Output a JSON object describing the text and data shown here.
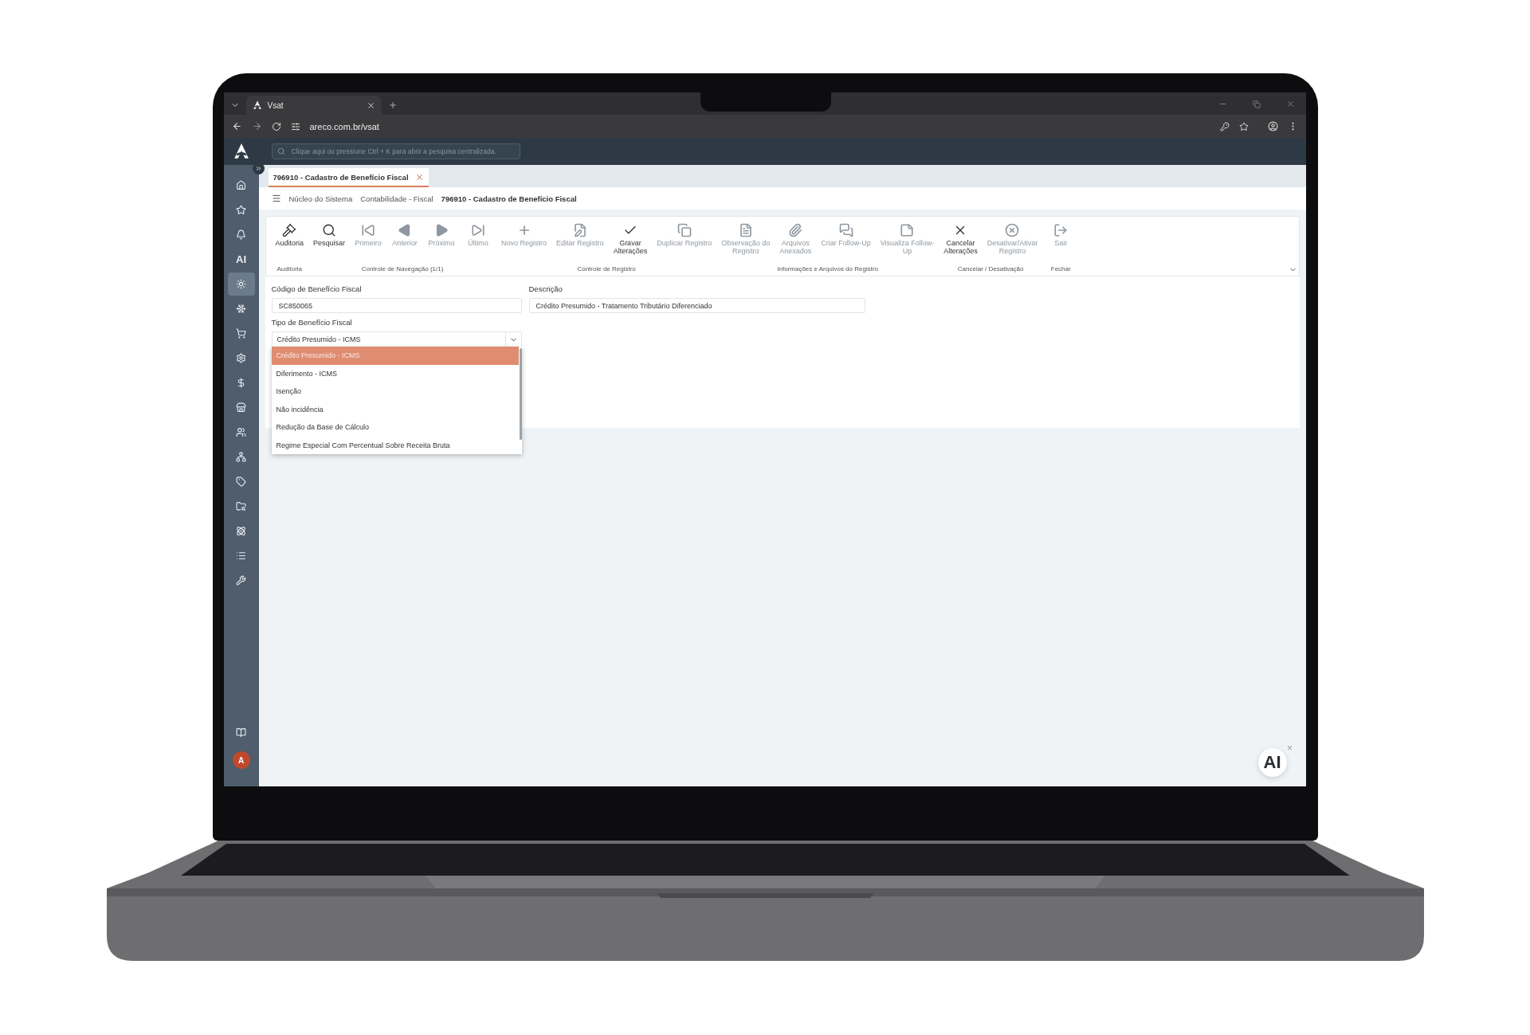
{
  "browser": {
    "tab": {
      "title": "Vsat"
    },
    "address": "areco.com.br/vsat"
  },
  "app": {
    "search": {
      "placeholder": "Clique aqui ou pressione Ctrl + K para abrir a pesquisa centralizada."
    }
  },
  "sidebar": {
    "items": [
      {
        "selected": false
      },
      {
        "selected": false
      },
      {
        "selected": false
      },
      {
        "label": "AI",
        "selected": false
      },
      {
        "selected": true
      },
      {
        "selected": false
      },
      {
        "selected": false
      },
      {
        "selected": false
      },
      {
        "selected": false
      },
      {
        "selected": false
      },
      {
        "selected": false
      },
      {
        "selected": false
      },
      {
        "selected": false
      },
      {
        "selected": false
      },
      {
        "selected": false
      },
      {
        "selected": false
      },
      {
        "selected": false
      }
    ],
    "avatar": "A"
  },
  "document_tabs": [
    {
      "label": "796910 - Cadastro de Benefício Fiscal",
      "selected": true
    }
  ],
  "breadcrumb": [
    {
      "label": "Núcleo do Sistema",
      "current": false
    },
    {
      "label": "Contabilidade - Fiscal",
      "current": false
    },
    {
      "label": "796910 - Cadastro de Benefício Fiscal",
      "current": true
    }
  ],
  "toolbar": {
    "groups": [
      {
        "label": "Auditoria",
        "buttons": [
          {
            "label": "Auditoria",
            "disabled": false
          }
        ]
      },
      {
        "label": "Controle de Navegação (1/1)",
        "buttons": [
          {
            "label": "Pesquisar",
            "disabled": false
          },
          {
            "label": "Primeiro",
            "disabled": true
          },
          {
            "label": "Anterior",
            "disabled": true
          },
          {
            "label": "Próximo",
            "disabled": true
          },
          {
            "label": "Último",
            "disabled": true
          }
        ]
      },
      {
        "label": "Controle de Registro",
        "buttons": [
          {
            "label": "Novo Registro",
            "disabled": true
          },
          {
            "label": "Editar Registro",
            "disabled": true
          },
          {
            "label": "Gravar\nAlterações",
            "disabled": false
          },
          {
            "label": "Duplicar Registro",
            "disabled": true
          }
        ]
      },
      {
        "label": "Informações e Arquivos do Registro",
        "buttons": [
          {
            "label": "Observação do\nRegistro",
            "disabled": true
          },
          {
            "label": "Arquivos\nAnexados",
            "disabled": true
          },
          {
            "label": "Criar Follow-Up",
            "disabled": true
          },
          {
            "label": "Visualiza Follow-\nUp",
            "disabled": true
          }
        ]
      },
      {
        "label": "Cancelar / Desativação",
        "buttons": [
          {
            "label": "Cancelar\nAlterações",
            "disabled": false
          },
          {
            "label": "Desativar/Ativar\nRegistro",
            "disabled": true
          }
        ]
      },
      {
        "label": "Fechar",
        "buttons": [
          {
            "label": "Sair",
            "disabled": true
          }
        ]
      }
    ]
  },
  "form": {
    "fields": [
      {
        "label": "Código de Benefício Fiscal",
        "value": "SC850065"
      },
      {
        "label": "Descrição",
        "value": "Crédito Presumido - Tratamento Tributário Diferenciado"
      }
    ],
    "select": {
      "label": "Tipo de Benefício Fiscal",
      "value": "Crédito Presumido - ICMS",
      "expanded": true,
      "options": [
        {
          "label": "Crédito Presumido - ICMS",
          "selected": true
        },
        {
          "label": "Diferimento - ICMS",
          "selected": false
        },
        {
          "label": "Isenção",
          "selected": false
        },
        {
          "label": "Não incidência",
          "selected": false
        },
        {
          "label": "Redução da Base de Cálculo",
          "selected": false
        },
        {
          "label": "Regime Especial Com Percentual Sobre Receita Bruta",
          "selected": false
        }
      ]
    }
  },
  "ai_button": {
    "label": "AI"
  }
}
